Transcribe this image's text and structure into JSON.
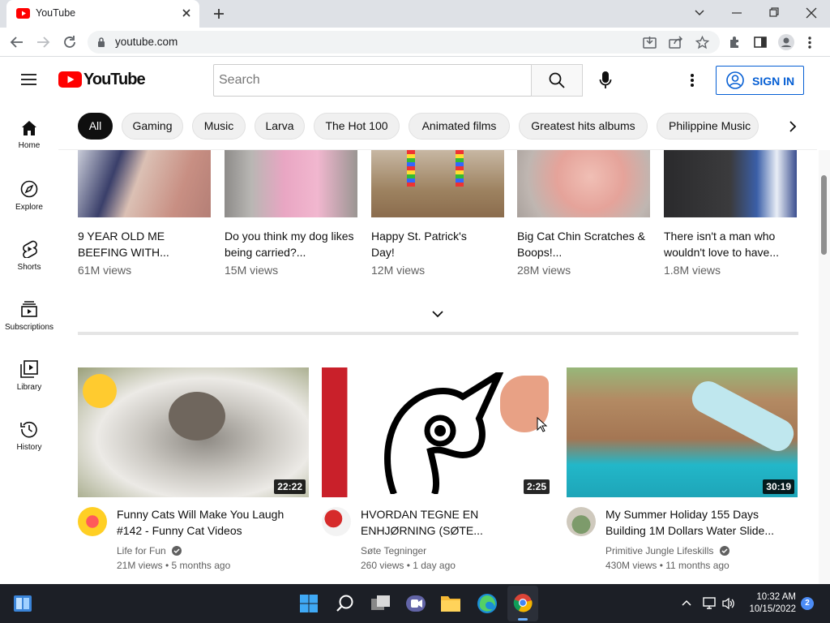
{
  "browser": {
    "tab_title": "YouTube",
    "url": "youtube.com"
  },
  "header": {
    "logo_text": "YouTube",
    "search_placeholder": "Search",
    "signin_label": "SIGN IN"
  },
  "sidebar": {
    "items": [
      {
        "label": "Home",
        "icon": "home-icon"
      },
      {
        "label": "Explore",
        "icon": "compass-icon"
      },
      {
        "label": "Shorts",
        "icon": "shorts-icon"
      },
      {
        "label": "Subscriptions",
        "icon": "subscriptions-icon"
      },
      {
        "label": "Library",
        "icon": "library-icon"
      },
      {
        "label": "History",
        "icon": "history-icon"
      }
    ]
  },
  "chips": [
    "All",
    "Gaming",
    "Music",
    "Larva",
    "The Hot 100",
    "Animated films",
    "Greatest hits albums",
    "Philippine Music"
  ],
  "shorts": [
    {
      "title": "9 YEAR OLD ME BEEFING WITH...",
      "views": "61M views"
    },
    {
      "title": "Do you think my dog likes being carried?...",
      "views": "15M views"
    },
    {
      "title": "Happy St. Patrick's Day!",
      "views": "12M views"
    },
    {
      "title": "Big Cat Chin Scratches & Boops!...",
      "views": "28M views"
    },
    {
      "title": "There isn't a man who wouldn't love to have...",
      "views": "1.8M views"
    }
  ],
  "videos": [
    {
      "title": "Funny Cats Will Make You Laugh #142 - Funny Cat Videos",
      "channel": "Life for Fun",
      "meta": "21M views • 5 months ago",
      "duration": "22:22"
    },
    {
      "title": "HVORDAN TEGNE EN ENHJØRNING (SØTE...",
      "channel": "Søte Tegninger",
      "meta": "260 views • 1 day ago",
      "duration": "2:25"
    },
    {
      "title": "My Summer Holiday 155 Days Building 1M Dollars Water Slide...",
      "channel": "Primitive Jungle Lifeskills",
      "meta": "430M views • 11 months ago",
      "duration": "30:19"
    }
  ],
  "taskbar": {
    "time": "10:32 AM",
    "date": "10/15/2022",
    "notifications": "2"
  },
  "colors": {
    "youtube_red": "#ff0000",
    "signin_blue": "#065fd4",
    "taskbar": "#1c1f26"
  }
}
